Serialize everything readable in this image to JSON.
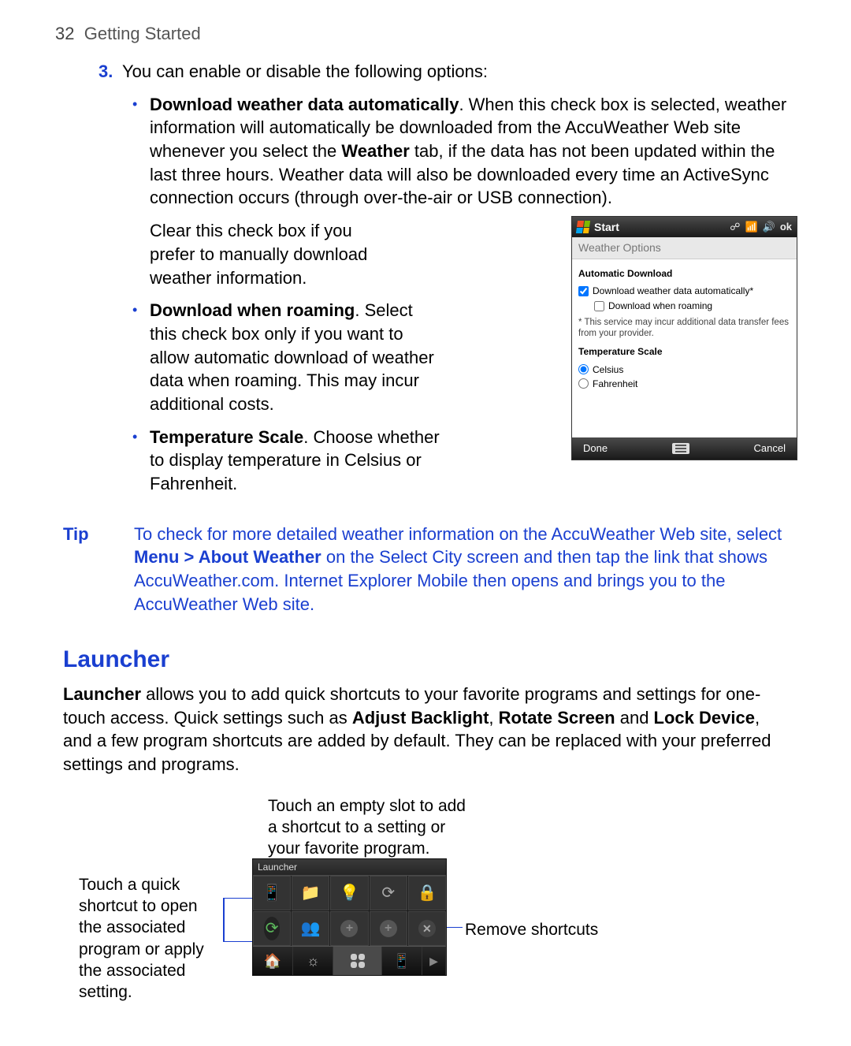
{
  "page": {
    "number": "32",
    "section": "Getting Started"
  },
  "step": {
    "num": "3.",
    "text": "You can enable or disable the following options:"
  },
  "bullets": {
    "b1_bold": "Download weather data automatically",
    "b1_text": ". When this check box is selected, weather information will automatically be downloaded from the AccuWeather Web site whenever you select the ",
    "b1_bold2": "Weather",
    "b1_text2": " tab, if the data has not been updated within the last three hours. Weather data will also be downloaded every time an ActiveSync connection occurs (through over-the-air or USB connection).",
    "b1_para2": "Clear this check box if you prefer to manually download weather information.",
    "b2_bold": "Download when roaming",
    "b2_text": ". Select this check box only if you want to allow automatic download of weather data when roaming. This may incur additional costs.",
    "b3_bold": "Temperature Scale",
    "b3_text": ". Choose whether to display temperature in Celsius or Fahrenheit."
  },
  "weatherOptions": {
    "start": "Start",
    "ok": "ok",
    "title": "Weather Options",
    "h1": "Automatic Download",
    "cb1": "Download weather data automatically*",
    "cb2": "Download when roaming",
    "note": "* This service may incur additional data transfer fees from your provider.",
    "h2": "Temperature Scale",
    "r1": "Celsius",
    "r2": "Fahrenheit",
    "done": "Done",
    "cancel": "Cancel"
  },
  "tip": {
    "label": "Tip",
    "t1": "To check for more detailed weather information on the AccuWeather Web site, select ",
    "bold": "Menu > About Weather",
    "t2": " on the Select City screen and then tap the link that shows AccuWeather.com. Internet Explorer Mobile then opens and brings you to the AccuWeather Web site."
  },
  "launcher": {
    "heading": "Launcher",
    "p_bold1": "Launcher",
    "p_t1": " allows you to add quick shortcuts to your favorite programs and settings for one-touch access. Quick settings such as ",
    "p_bold2": "Adjust Backlight",
    "p_t2": ", ",
    "p_bold3": "Rotate Screen",
    "p_t3": " and ",
    "p_bold4": "Lock Device",
    "p_t4": ", and a few program shortcuts are added by default. They can be replaced with your preferred settings and programs.",
    "cap_top": "Touch an empty slot to add a shortcut to a setting or your favorite program.",
    "cap_left": "Touch a quick shortcut to open the associated program or apply the associated setting.",
    "cap_right": "Remove shortcuts",
    "title": "Launcher"
  }
}
